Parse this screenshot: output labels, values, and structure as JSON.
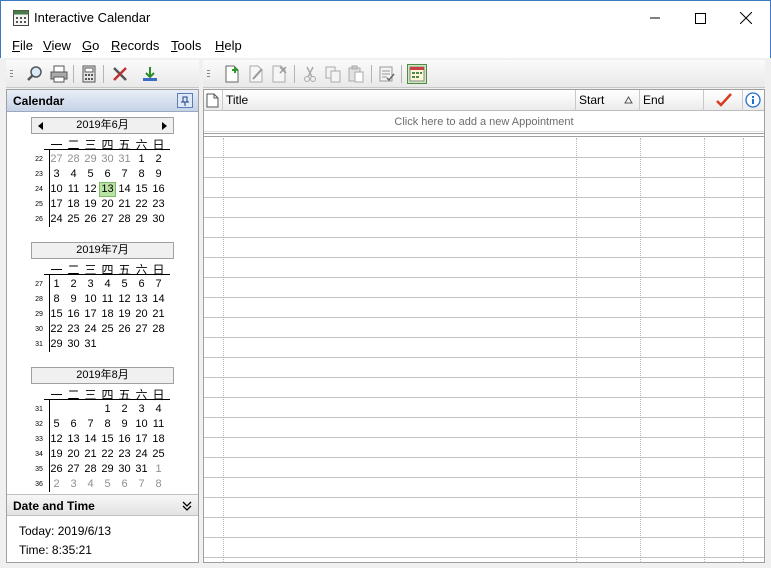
{
  "window": {
    "title": "Interactive Calendar"
  },
  "menu": [
    {
      "label": "File",
      "ul": "F",
      "rest": "ile"
    },
    {
      "label": "View",
      "ul": "V",
      "rest": "iew"
    },
    {
      "label": "Go",
      "ul": "G",
      "rest": "o"
    },
    {
      "label": "Records",
      "ul": "R",
      "rest": "ecords"
    },
    {
      "label": "Tools",
      "ul": "T",
      "rest": "ools"
    },
    {
      "label": "Help",
      "ul": "H",
      "rest": "elp"
    }
  ],
  "left_toolbar": [
    "find-icon",
    "print-icon",
    "calculator-icon",
    "tools-icon",
    "download-icon"
  ],
  "right_toolbar": [
    "new-icon",
    "edit-icon",
    "delete-icon",
    "cut-icon",
    "copy-icon",
    "paste-icon",
    "check-list-icon",
    "view-icon"
  ],
  "calendar_pane": {
    "title": "Calendar",
    "weekdays": [
      "一",
      "二",
      "三",
      "四",
      "五",
      "六",
      "日"
    ],
    "months": [
      {
        "title": "2019年6月",
        "weeks": [
          {
            "no": "22",
            "days": [
              [
                "27",
                1
              ],
              [
                "28",
                1
              ],
              [
                "29",
                1
              ],
              [
                "30",
                1
              ],
              [
                "31",
                1
              ],
              [
                "1",
                0
              ],
              [
                "2",
                0
              ]
            ]
          },
          {
            "no": "23",
            "days": [
              [
                "3",
                0
              ],
              [
                "4",
                0
              ],
              [
                "5",
                0
              ],
              [
                "6",
                0
              ],
              [
                "7",
                0
              ],
              [
                "8",
                0
              ],
              [
                "9",
                0
              ]
            ]
          },
          {
            "no": "24",
            "days": [
              [
                "10",
                0
              ],
              [
                "11",
                0
              ],
              [
                "12",
                0
              ],
              [
                "13",
                2
              ],
              [
                "14",
                0
              ],
              [
                "15",
                0
              ],
              [
                "16",
                0
              ]
            ]
          },
          {
            "no": "25",
            "days": [
              [
                "17",
                0
              ],
              [
                "18",
                0
              ],
              [
                "19",
                0
              ],
              [
                "20",
                0
              ],
              [
                "21",
                0
              ],
              [
                "22",
                0
              ],
              [
                "23",
                0
              ]
            ]
          },
          {
            "no": "26",
            "days": [
              [
                "24",
                0
              ],
              [
                "25",
                0
              ],
              [
                "26",
                0
              ],
              [
                "27",
                0
              ],
              [
                "28",
                0
              ],
              [
                "29",
                0
              ],
              [
                "30",
                0
              ]
            ]
          }
        ]
      },
      {
        "title": "2019年7月",
        "weeks": [
          {
            "no": "27",
            "days": [
              [
                "1",
                0
              ],
              [
                "2",
                0
              ],
              [
                "3",
                0
              ],
              [
                "4",
                0
              ],
              [
                "5",
                0
              ],
              [
                "6",
                0
              ],
              [
                "7",
                0
              ]
            ]
          },
          {
            "no": "28",
            "days": [
              [
                "8",
                0
              ],
              [
                "9",
                0
              ],
              [
                "10",
                0
              ],
              [
                "11",
                0
              ],
              [
                "12",
                0
              ],
              [
                "13",
                0
              ],
              [
                "14",
                0
              ]
            ]
          },
          {
            "no": "29",
            "days": [
              [
                "15",
                0
              ],
              [
                "16",
                0
              ],
              [
                "17",
                0
              ],
              [
                "18",
                0
              ],
              [
                "19",
                0
              ],
              [
                "20",
                0
              ],
              [
                "21",
                0
              ]
            ]
          },
          {
            "no": "30",
            "days": [
              [
                "22",
                0
              ],
              [
                "23",
                0
              ],
              [
                "24",
                0
              ],
              [
                "25",
                0
              ],
              [
                "26",
                0
              ],
              [
                "27",
                0
              ],
              [
                "28",
                0
              ]
            ]
          },
          {
            "no": "31",
            "days": [
              [
                "29",
                0
              ],
              [
                "30",
                0
              ],
              [
                "31",
                0
              ],
              [
                "",
                0
              ],
              [
                "",
                0
              ],
              [
                "",
                0
              ],
              [
                "",
                0
              ]
            ]
          }
        ]
      },
      {
        "title": "2019年8月",
        "weeks": [
          {
            "no": "31",
            "days": [
              [
                "",
                0
              ],
              [
                "",
                0
              ],
              [
                "",
                0
              ],
              [
                "1",
                0
              ],
              [
                "2",
                0
              ],
              [
                "3",
                0
              ],
              [
                "4",
                0
              ]
            ]
          },
          {
            "no": "32",
            "days": [
              [
                "5",
                0
              ],
              [
                "6",
                0
              ],
              [
                "7",
                0
              ],
              [
                "8",
                0
              ],
              [
                "9",
                0
              ],
              [
                "10",
                0
              ],
              [
                "11",
                0
              ]
            ]
          },
          {
            "no": "33",
            "days": [
              [
                "12",
                0
              ],
              [
                "13",
                0
              ],
              [
                "14",
                0
              ],
              [
                "15",
                0
              ],
              [
                "16",
                0
              ],
              [
                "17",
                0
              ],
              [
                "18",
                0
              ]
            ]
          },
          {
            "no": "34",
            "days": [
              [
                "19",
                0
              ],
              [
                "20",
                0
              ],
              [
                "21",
                0
              ],
              [
                "22",
                0
              ],
              [
                "23",
                0
              ],
              [
                "24",
                0
              ],
              [
                "25",
                0
              ]
            ]
          },
          {
            "no": "35",
            "days": [
              [
                "26",
                0
              ],
              [
                "27",
                0
              ],
              [
                "28",
                0
              ],
              [
                "29",
                0
              ],
              [
                "30",
                0
              ],
              [
                "31",
                0
              ],
              [
                "1",
                1
              ]
            ]
          },
          {
            "no": "36",
            "days": [
              [
                "2",
                1
              ],
              [
                "3",
                1
              ],
              [
                "4",
                1
              ],
              [
                "5",
                1
              ],
              [
                "6",
                1
              ],
              [
                "7",
                1
              ],
              [
                "8",
                1
              ]
            ]
          }
        ]
      }
    ]
  },
  "date_time": {
    "title": "Date and Time",
    "today": "Today: 2019/6/13",
    "time": "Time: 8:35:21"
  },
  "grid": {
    "columns": {
      "title": "Title",
      "start": "Start",
      "end": "End"
    },
    "new_row": "Click here to add a new Appointment",
    "colors": {
      "check": "#d83b1d",
      "info": "#1f6fd0"
    }
  }
}
